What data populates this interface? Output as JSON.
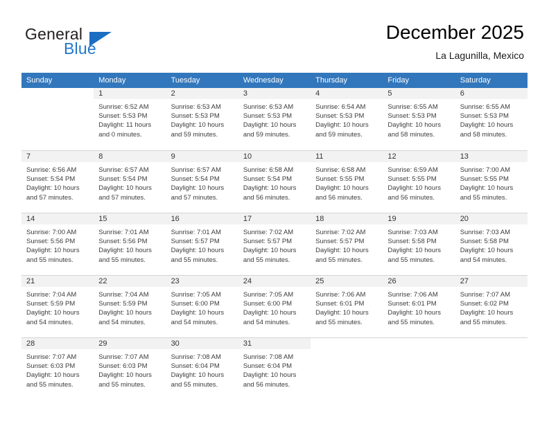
{
  "brand": {
    "name_part1": "General",
    "name_part2": "Blue",
    "flag_icon": "flag-triangle-icon"
  },
  "header": {
    "title": "December 2025",
    "location": "La Lagunilla, Mexico"
  },
  "weekday_headers": [
    "Sunday",
    "Monday",
    "Tuesday",
    "Wednesday",
    "Thursday",
    "Friday",
    "Saturday"
  ],
  "colors": {
    "header_blue": "#3277bc",
    "brand_blue": "#2277c8",
    "daynum_band": "#f2f2f2",
    "grid_line": "#d4d4d4",
    "text": "#333333"
  },
  "weeks": [
    {
      "days": [
        {
          "day": "",
          "sunrise": "",
          "sunset": "",
          "daylight_line1": "",
          "daylight_line2": ""
        },
        {
          "day": "1",
          "sunrise": "Sunrise: 6:52 AM",
          "sunset": "Sunset: 5:53 PM",
          "daylight_line1": "Daylight: 11 hours",
          "daylight_line2": "and 0 minutes."
        },
        {
          "day": "2",
          "sunrise": "Sunrise: 6:53 AM",
          "sunset": "Sunset: 5:53 PM",
          "daylight_line1": "Daylight: 10 hours",
          "daylight_line2": "and 59 minutes."
        },
        {
          "day": "3",
          "sunrise": "Sunrise: 6:53 AM",
          "sunset": "Sunset: 5:53 PM",
          "daylight_line1": "Daylight: 10 hours",
          "daylight_line2": "and 59 minutes."
        },
        {
          "day": "4",
          "sunrise": "Sunrise: 6:54 AM",
          "sunset": "Sunset: 5:53 PM",
          "daylight_line1": "Daylight: 10 hours",
          "daylight_line2": "and 59 minutes."
        },
        {
          "day": "5",
          "sunrise": "Sunrise: 6:55 AM",
          "sunset": "Sunset: 5:53 PM",
          "daylight_line1": "Daylight: 10 hours",
          "daylight_line2": "and 58 minutes."
        },
        {
          "day": "6",
          "sunrise": "Sunrise: 6:55 AM",
          "sunset": "Sunset: 5:53 PM",
          "daylight_line1": "Daylight: 10 hours",
          "daylight_line2": "and 58 minutes."
        }
      ]
    },
    {
      "days": [
        {
          "day": "7",
          "sunrise": "Sunrise: 6:56 AM",
          "sunset": "Sunset: 5:54 PM",
          "daylight_line1": "Daylight: 10 hours",
          "daylight_line2": "and 57 minutes."
        },
        {
          "day": "8",
          "sunrise": "Sunrise: 6:57 AM",
          "sunset": "Sunset: 5:54 PM",
          "daylight_line1": "Daylight: 10 hours",
          "daylight_line2": "and 57 minutes."
        },
        {
          "day": "9",
          "sunrise": "Sunrise: 6:57 AM",
          "sunset": "Sunset: 5:54 PM",
          "daylight_line1": "Daylight: 10 hours",
          "daylight_line2": "and 57 minutes."
        },
        {
          "day": "10",
          "sunrise": "Sunrise: 6:58 AM",
          "sunset": "Sunset: 5:54 PM",
          "daylight_line1": "Daylight: 10 hours",
          "daylight_line2": "and 56 minutes."
        },
        {
          "day": "11",
          "sunrise": "Sunrise: 6:58 AM",
          "sunset": "Sunset: 5:55 PM",
          "daylight_line1": "Daylight: 10 hours",
          "daylight_line2": "and 56 minutes."
        },
        {
          "day": "12",
          "sunrise": "Sunrise: 6:59 AM",
          "sunset": "Sunset: 5:55 PM",
          "daylight_line1": "Daylight: 10 hours",
          "daylight_line2": "and 56 minutes."
        },
        {
          "day": "13",
          "sunrise": "Sunrise: 7:00 AM",
          "sunset": "Sunset: 5:55 PM",
          "daylight_line1": "Daylight: 10 hours",
          "daylight_line2": "and 55 minutes."
        }
      ]
    },
    {
      "days": [
        {
          "day": "14",
          "sunrise": "Sunrise: 7:00 AM",
          "sunset": "Sunset: 5:56 PM",
          "daylight_line1": "Daylight: 10 hours",
          "daylight_line2": "and 55 minutes."
        },
        {
          "day": "15",
          "sunrise": "Sunrise: 7:01 AM",
          "sunset": "Sunset: 5:56 PM",
          "daylight_line1": "Daylight: 10 hours",
          "daylight_line2": "and 55 minutes."
        },
        {
          "day": "16",
          "sunrise": "Sunrise: 7:01 AM",
          "sunset": "Sunset: 5:57 PM",
          "daylight_line1": "Daylight: 10 hours",
          "daylight_line2": "and 55 minutes."
        },
        {
          "day": "17",
          "sunrise": "Sunrise: 7:02 AM",
          "sunset": "Sunset: 5:57 PM",
          "daylight_line1": "Daylight: 10 hours",
          "daylight_line2": "and 55 minutes."
        },
        {
          "day": "18",
          "sunrise": "Sunrise: 7:02 AM",
          "sunset": "Sunset: 5:57 PM",
          "daylight_line1": "Daylight: 10 hours",
          "daylight_line2": "and 55 minutes."
        },
        {
          "day": "19",
          "sunrise": "Sunrise: 7:03 AM",
          "sunset": "Sunset: 5:58 PM",
          "daylight_line1": "Daylight: 10 hours",
          "daylight_line2": "and 55 minutes."
        },
        {
          "day": "20",
          "sunrise": "Sunrise: 7:03 AM",
          "sunset": "Sunset: 5:58 PM",
          "daylight_line1": "Daylight: 10 hours",
          "daylight_line2": "and 54 minutes."
        }
      ]
    },
    {
      "days": [
        {
          "day": "21",
          "sunrise": "Sunrise: 7:04 AM",
          "sunset": "Sunset: 5:59 PM",
          "daylight_line1": "Daylight: 10 hours",
          "daylight_line2": "and 54 minutes."
        },
        {
          "day": "22",
          "sunrise": "Sunrise: 7:04 AM",
          "sunset": "Sunset: 5:59 PM",
          "daylight_line1": "Daylight: 10 hours",
          "daylight_line2": "and 54 minutes."
        },
        {
          "day": "23",
          "sunrise": "Sunrise: 7:05 AM",
          "sunset": "Sunset: 6:00 PM",
          "daylight_line1": "Daylight: 10 hours",
          "daylight_line2": "and 54 minutes."
        },
        {
          "day": "24",
          "sunrise": "Sunrise: 7:05 AM",
          "sunset": "Sunset: 6:00 PM",
          "daylight_line1": "Daylight: 10 hours",
          "daylight_line2": "and 54 minutes."
        },
        {
          "day": "25",
          "sunrise": "Sunrise: 7:06 AM",
          "sunset": "Sunset: 6:01 PM",
          "daylight_line1": "Daylight: 10 hours",
          "daylight_line2": "and 55 minutes."
        },
        {
          "day": "26",
          "sunrise": "Sunrise: 7:06 AM",
          "sunset": "Sunset: 6:01 PM",
          "daylight_line1": "Daylight: 10 hours",
          "daylight_line2": "and 55 minutes."
        },
        {
          "day": "27",
          "sunrise": "Sunrise: 7:07 AM",
          "sunset": "Sunset: 6:02 PM",
          "daylight_line1": "Daylight: 10 hours",
          "daylight_line2": "and 55 minutes."
        }
      ]
    },
    {
      "days": [
        {
          "day": "28",
          "sunrise": "Sunrise: 7:07 AM",
          "sunset": "Sunset: 6:03 PM",
          "daylight_line1": "Daylight: 10 hours",
          "daylight_line2": "and 55 minutes."
        },
        {
          "day": "29",
          "sunrise": "Sunrise: 7:07 AM",
          "sunset": "Sunset: 6:03 PM",
          "daylight_line1": "Daylight: 10 hours",
          "daylight_line2": "and 55 minutes."
        },
        {
          "day": "30",
          "sunrise": "Sunrise: 7:08 AM",
          "sunset": "Sunset: 6:04 PM",
          "daylight_line1": "Daylight: 10 hours",
          "daylight_line2": "and 55 minutes."
        },
        {
          "day": "31",
          "sunrise": "Sunrise: 7:08 AM",
          "sunset": "Sunset: 6:04 PM",
          "daylight_line1": "Daylight: 10 hours",
          "daylight_line2": "and 56 minutes."
        },
        {
          "day": "",
          "sunrise": "",
          "sunset": "",
          "daylight_line1": "",
          "daylight_line2": ""
        },
        {
          "day": "",
          "sunrise": "",
          "sunset": "",
          "daylight_line1": "",
          "daylight_line2": ""
        },
        {
          "day": "",
          "sunrise": "",
          "sunset": "",
          "daylight_line1": "",
          "daylight_line2": ""
        }
      ]
    }
  ]
}
